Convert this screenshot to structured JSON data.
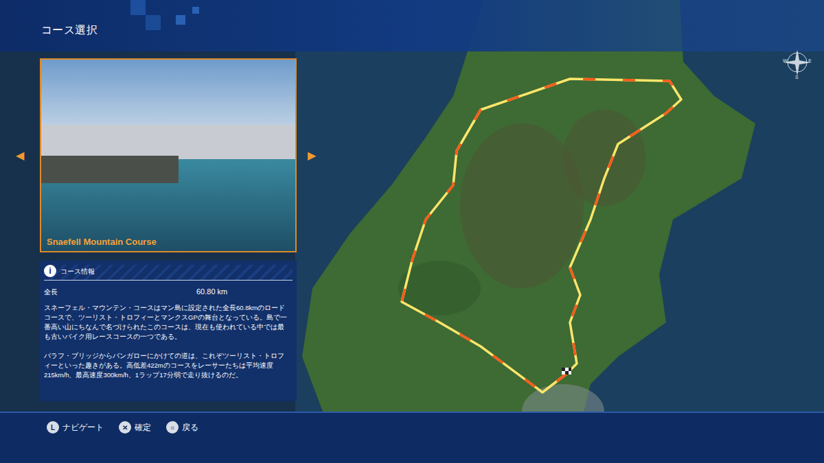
{
  "screen_title": "コース選択",
  "course_card": {
    "name": "Snaefell Mountain Course",
    "prev_arrow": "◀",
    "next_arrow": "▶"
  },
  "course_info": {
    "heading": "コース情報",
    "info_icon": "i",
    "stats": [
      {
        "label": "全長",
        "value": "60.80 km"
      }
    ],
    "description": [
      "スネーフェル・マウンテン・コースはマン島に設定された全長60.8kmのロードコースで、ツーリスト・トロフィーとマンクスGPの舞台となっている。島で一番高い山にちなんで名づけられたこのコースは、現在も使われている中では最も古いバイク用レースコースの一つである。",
      "バラフ・ブリッジからバンガローにかけての道は、これぞツーリスト・トロフィーといった趣きがある。高低差422mのコースをレーサーたちは平均速度215km/h、最高速度300km/h、1ラップ17分弱で走り抜けるのだ。"
    ]
  },
  "compass": {
    "labels": [
      "W",
      "E",
      "S"
    ]
  },
  "controls": [
    {
      "glyph": "L",
      "label": "ナビゲート"
    },
    {
      "glyph": "✕",
      "label": "確定"
    },
    {
      "glyph": "○",
      "label": "戻る"
    }
  ]
}
